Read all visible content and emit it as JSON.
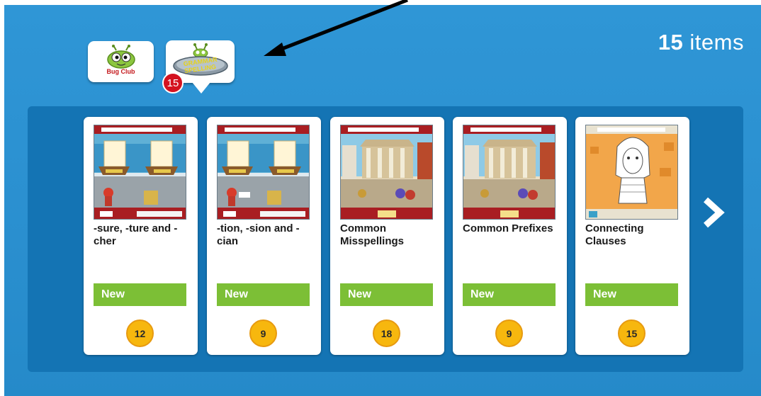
{
  "header": {
    "items_number": "15",
    "items_word": "items"
  },
  "tabs": [
    {
      "label": "Bug Club"
    },
    {
      "label": "Grammar Spelling",
      "count": "15"
    }
  ],
  "cards": [
    {
      "title": "-sure, -ture and -cher",
      "status": "New",
      "count": "12",
      "thumb": "harbour-game"
    },
    {
      "title": "-tion, -sion and -cian",
      "status": "New",
      "count": "9",
      "thumb": "harbour-game"
    },
    {
      "title": "Common Misspellings",
      "status": "New",
      "count": "18",
      "thumb": "temple-game"
    },
    {
      "title": "Common Prefixes",
      "status": "New",
      "count": "9",
      "thumb": "temple-game"
    },
    {
      "title": "Connecting Clauses",
      "status": "New",
      "count": "15",
      "thumb": "pharaoh-game"
    }
  ],
  "icons": {
    "next": "chevron-right-icon",
    "annotation": "black-arrow-annotation"
  },
  "colors": {
    "background": "#2f96d6",
    "panel": "#1474b4",
    "new_badge": "#7cbf36",
    "count_circle": "#f7b70e",
    "tab_badge": "#d4121f"
  }
}
